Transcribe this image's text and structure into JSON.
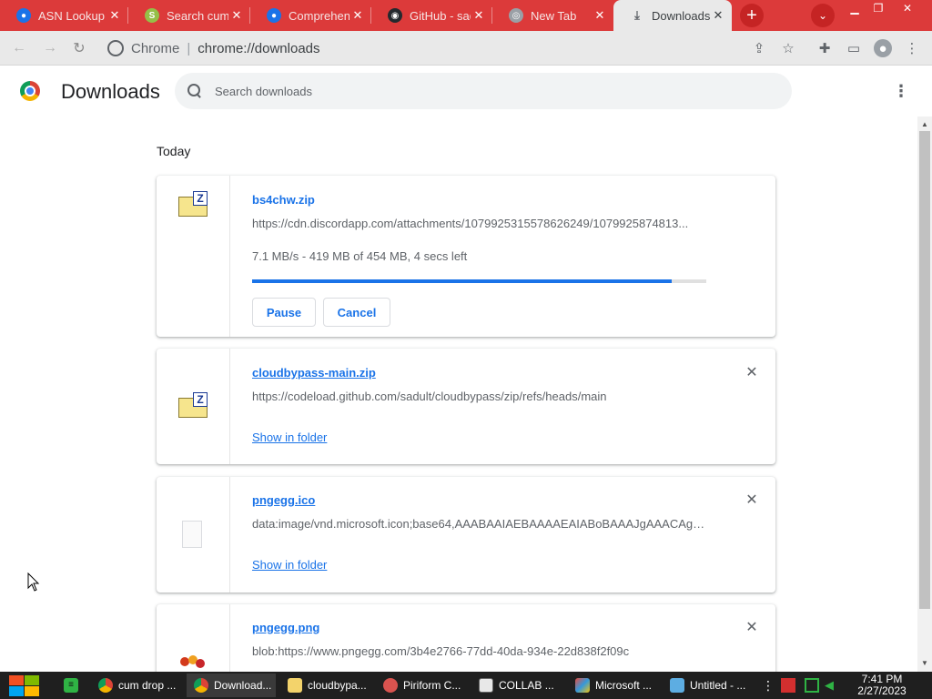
{
  "tabs": [
    {
      "title": "ASN Lookup",
      "icon": "location-pin-icon",
      "color": "#1a73e8"
    },
    {
      "title": "Search cum",
      "icon": "shopify-icon",
      "color": "#95bf47"
    },
    {
      "title": "Comprehensive",
      "icon": "location-pin-icon",
      "color": "#1a73e8"
    },
    {
      "title": "GitHub - sadult",
      "icon": "github-icon",
      "color": "#24292e"
    },
    {
      "title": "New Tab",
      "icon": "chrome-icon",
      "color": "#9aa0a6"
    },
    {
      "title": "Downloads",
      "icon": "download-icon",
      "color": "#5f6368"
    }
  ],
  "omnibox": {
    "site": "Chrome",
    "url": "chrome://downloads"
  },
  "header": {
    "title": "Downloads",
    "search_placeholder": "Search downloads"
  },
  "section": {
    "date": "Today"
  },
  "downloads": [
    {
      "filename": "bs4chw.zip",
      "url": "https://cdn.discordapp.com/attachments/1079925315578626249/1079925874813...",
      "status": "7.1 MB/s - 419 MB of 454 MB, 4 secs left",
      "progress": 0.923,
      "pause_label": "Pause",
      "cancel_label": "Cancel"
    },
    {
      "filename": "cloudbypass-main.zip",
      "url": "https://codeload.github.com/sadult/cloudbypass/zip/refs/heads/main",
      "action": "Show in folder"
    },
    {
      "filename": "pngegg.ico",
      "url": "data:image/vnd.microsoft.icon;base64,AAABAAIAEBAAAAEAIABoBAAAJgAAACAgA...",
      "action": "Show in folder"
    },
    {
      "filename": "pngegg.png",
      "url": "blob:https://www.pngegg.com/3b4e2766-77dd-40da-934e-22d838f2f09c"
    }
  ],
  "taskbar": {
    "items": [
      {
        "label": "cum drop ...",
        "icon": "chrome-icon"
      },
      {
        "label": "Download...",
        "icon": "chrome-icon"
      },
      {
        "label": "cloudbypa...",
        "icon": "folder-icon"
      },
      {
        "label": "Piriform C...",
        "icon": "ccleaner-icon"
      },
      {
        "label": "COLLAB ...",
        "icon": "collab-icon"
      },
      {
        "label": "Microsoft ...",
        "icon": "paint-icon"
      },
      {
        "label": "Untitled - ...",
        "icon": "notepad-icon"
      }
    ],
    "time": "7:41 PM",
    "date": "2/27/2023"
  }
}
